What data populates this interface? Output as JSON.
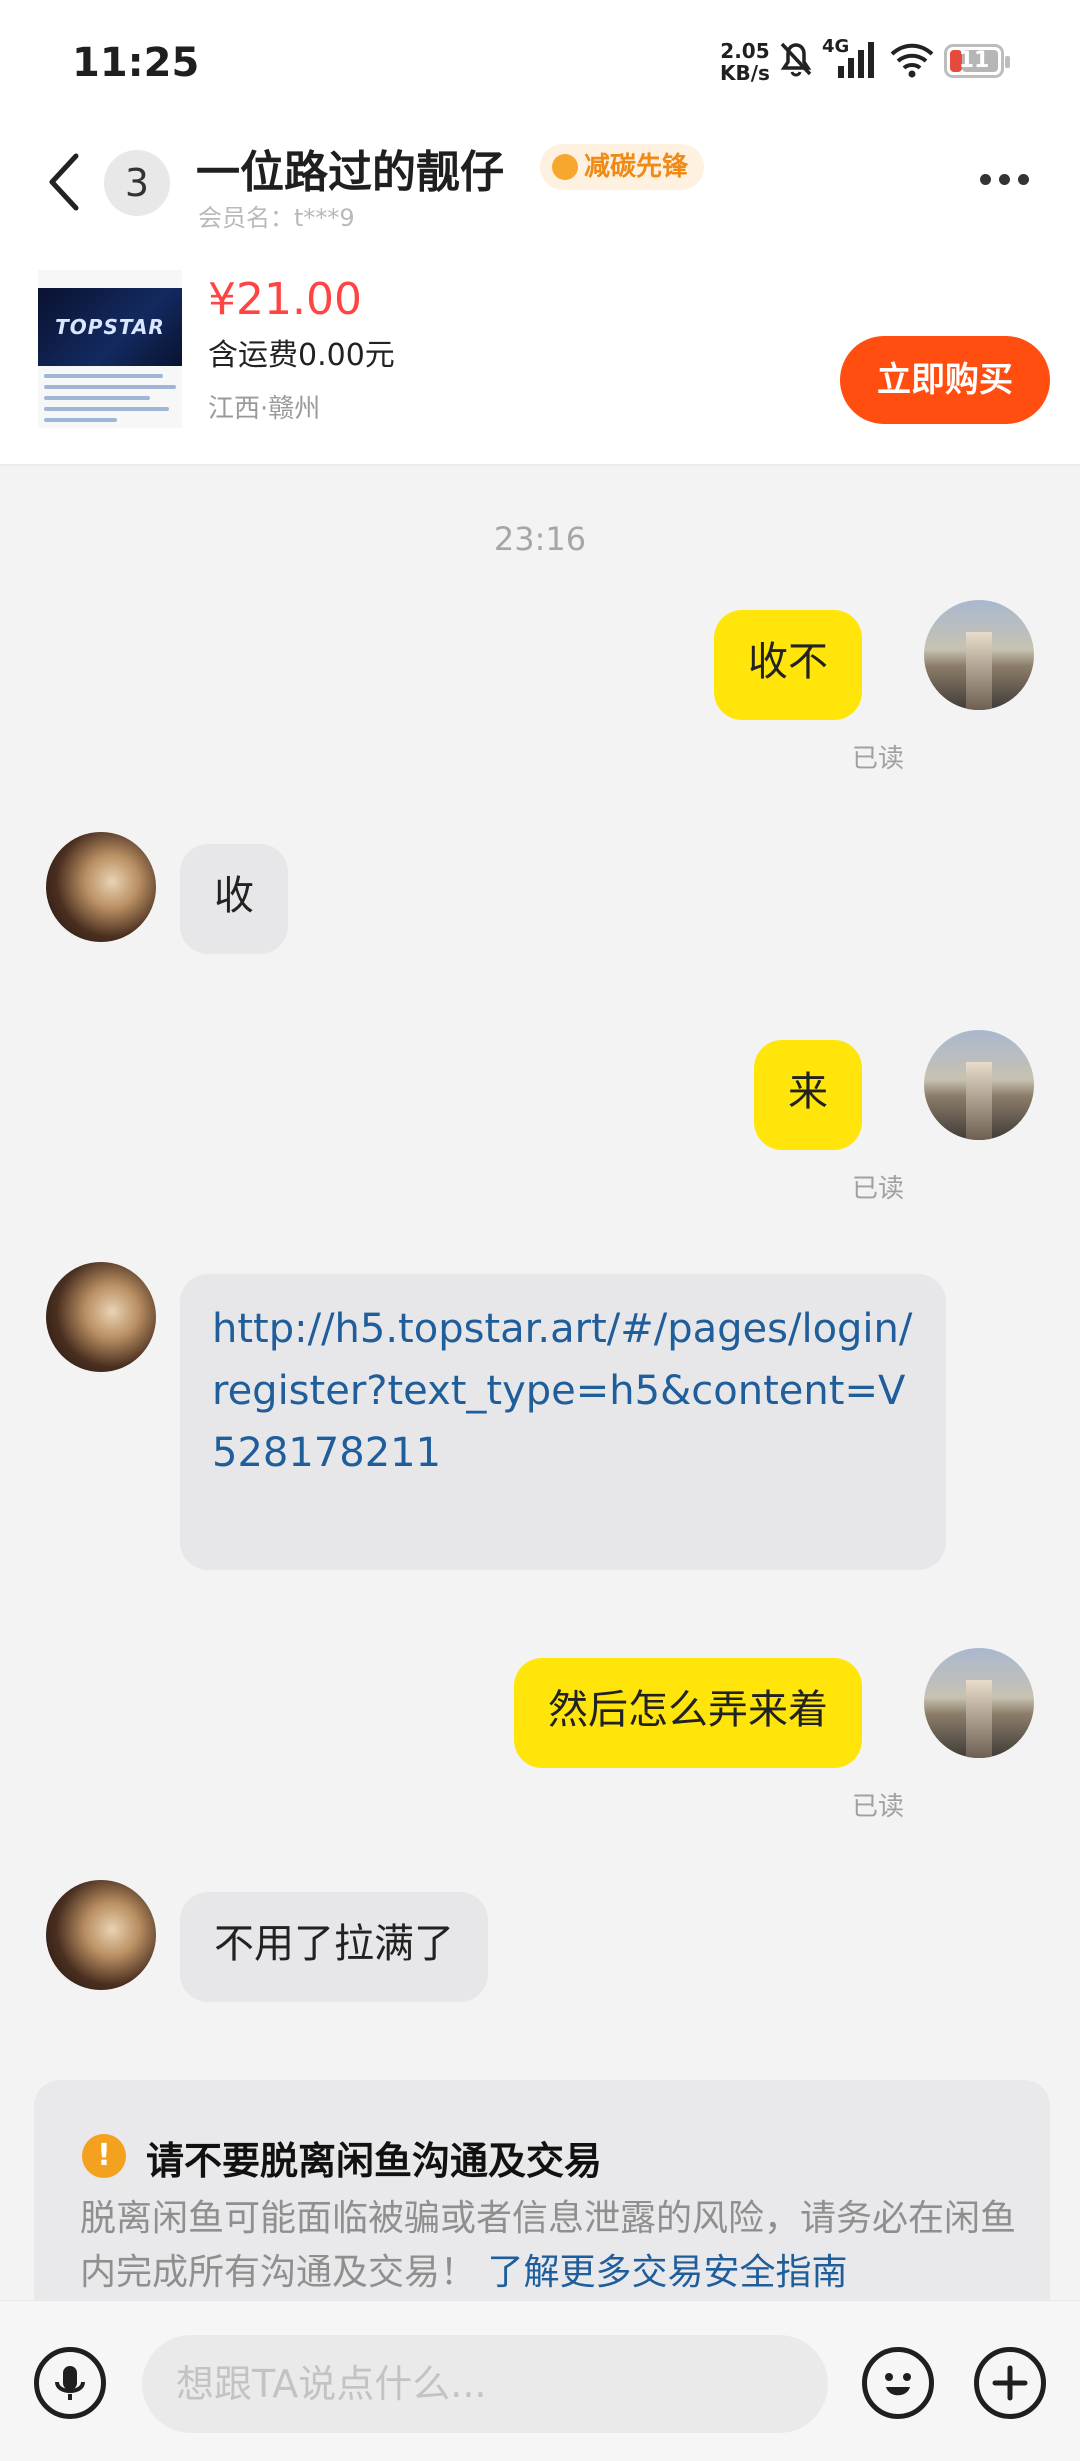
{
  "status_bar": {
    "time": "11:25",
    "net_speed_value": "2.05",
    "net_speed_unit": "KB/s",
    "network": "4G",
    "battery": "11"
  },
  "header": {
    "unread_count": "3",
    "username": "一位路过的靓仔",
    "badge": "减碳先锋",
    "member_label": "会员名：t***9"
  },
  "product": {
    "price": "¥21.00",
    "shipping": "含运费0.00元",
    "location": "江西·赣州",
    "buy_label": "立即购买",
    "thumb_text": "TOPSTAR"
  },
  "chat": {
    "timestamp": "23:16",
    "messages": [
      {
        "from": "me",
        "text": "收不",
        "status": "已读"
      },
      {
        "from": "other",
        "text": "收"
      },
      {
        "from": "me",
        "text": "来",
        "status": "已读"
      },
      {
        "from": "other",
        "text": "http://h5.topstar.art/#/pages/login/register?text_type=h5&content=V528178211"
      },
      {
        "from": "me",
        "text": "然后怎么弄来着",
        "status": "已读"
      },
      {
        "from": "other",
        "text": "不用了拉满了"
      }
    ]
  },
  "warning": {
    "title": "请不要脱离闲鱼沟通及交易",
    "body": "脱离闲鱼可能面临被骗或者信息泄露的风险，请务必在闲鱼内完成所有沟通及交易！",
    "link": "了解更多交易安全指南"
  },
  "input": {
    "placeholder": "想跟TA说点什么..."
  },
  "colors": {
    "accent_yellow": "#ffe50a",
    "buy_orange": "#ff4e0f",
    "price_red": "#ff4444",
    "link_blue": "#1f5e9a"
  }
}
